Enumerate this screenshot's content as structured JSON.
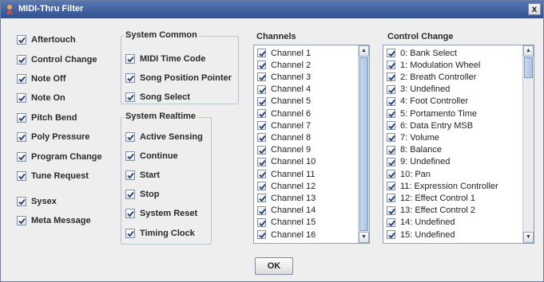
{
  "window": {
    "title": "MIDI-Thru Filter",
    "close_label": "x"
  },
  "left_options": [
    {
      "label": "Aftertouch",
      "checked": true
    },
    {
      "label": "Control Change",
      "checked": true
    },
    {
      "label": "Note Off",
      "checked": true
    },
    {
      "label": "Note On",
      "checked": true
    },
    {
      "label": "Pitch Bend",
      "checked": true
    },
    {
      "label": "Poly Pressure",
      "checked": true
    },
    {
      "label": "Program Change",
      "checked": true
    },
    {
      "label": "Tune Request",
      "checked": true
    },
    {
      "label": "Sysex",
      "checked": true
    },
    {
      "label": "Meta Message",
      "checked": true
    }
  ],
  "system_common": {
    "title": "System Common",
    "items": [
      {
        "label": "MIDI Time Code",
        "checked": true
      },
      {
        "label": "Song Position Pointer",
        "checked": true
      },
      {
        "label": "Song Select",
        "checked": true
      }
    ]
  },
  "system_realtime": {
    "title": "System Realtime",
    "items": [
      {
        "label": "Active Sensing",
        "checked": true
      },
      {
        "label": "Continue",
        "checked": true
      },
      {
        "label": "Start",
        "checked": true
      },
      {
        "label": "Stop",
        "checked": true
      },
      {
        "label": "System Reset",
        "checked": true
      },
      {
        "label": "Timing Clock",
        "checked": true
      }
    ]
  },
  "channels": {
    "title": "Channels",
    "items": [
      {
        "label": "Channel 1",
        "checked": true
      },
      {
        "label": "Channel 2",
        "checked": true
      },
      {
        "label": "Channel 3",
        "checked": true
      },
      {
        "label": "Channel 4",
        "checked": true
      },
      {
        "label": "Channel 5",
        "checked": true
      },
      {
        "label": "Channel 6",
        "checked": true
      },
      {
        "label": "Channel 7",
        "checked": true
      },
      {
        "label": "Channel 8",
        "checked": true
      },
      {
        "label": "Channel 9",
        "checked": true
      },
      {
        "label": "Channel 10",
        "checked": true
      },
      {
        "label": "Channel 11",
        "checked": true
      },
      {
        "label": "Channel 12",
        "checked": true
      },
      {
        "label": "Channel 13",
        "checked": true
      },
      {
        "label": "Channel 14",
        "checked": true
      },
      {
        "label": "Channel 15",
        "checked": true
      },
      {
        "label": "Channel 16",
        "checked": true
      }
    ]
  },
  "control_change": {
    "title": "Control Change",
    "items": [
      {
        "label": "0: Bank Select",
        "checked": true
      },
      {
        "label": "1: Modulation Wheel",
        "checked": true
      },
      {
        "label": "2: Breath Controller",
        "checked": true
      },
      {
        "label": "3: Undefined",
        "checked": true
      },
      {
        "label": "4: Foot Controller",
        "checked": true
      },
      {
        "label": "5: Portamento Time",
        "checked": true
      },
      {
        "label": "6: Data Entry MSB",
        "checked": true
      },
      {
        "label": "7: Volume",
        "checked": true
      },
      {
        "label": "8: Balance",
        "checked": true
      },
      {
        "label": "9: Undefined",
        "checked": true
      },
      {
        "label": "10: Pan",
        "checked": true
      },
      {
        "label": "11: Expression Controller",
        "checked": true
      },
      {
        "label": "12: Effect Control 1",
        "checked": true
      },
      {
        "label": "13: Effect Control 2",
        "checked": true
      },
      {
        "label": "14: Undefined",
        "checked": true
      },
      {
        "label": "15: Undefined",
        "checked": true
      }
    ]
  },
  "ok_label": "OK",
  "icons": {
    "app": "midi-app-icon",
    "check": "checkmark-icon",
    "up": "scroll-up-icon",
    "down": "scroll-down-icon"
  }
}
